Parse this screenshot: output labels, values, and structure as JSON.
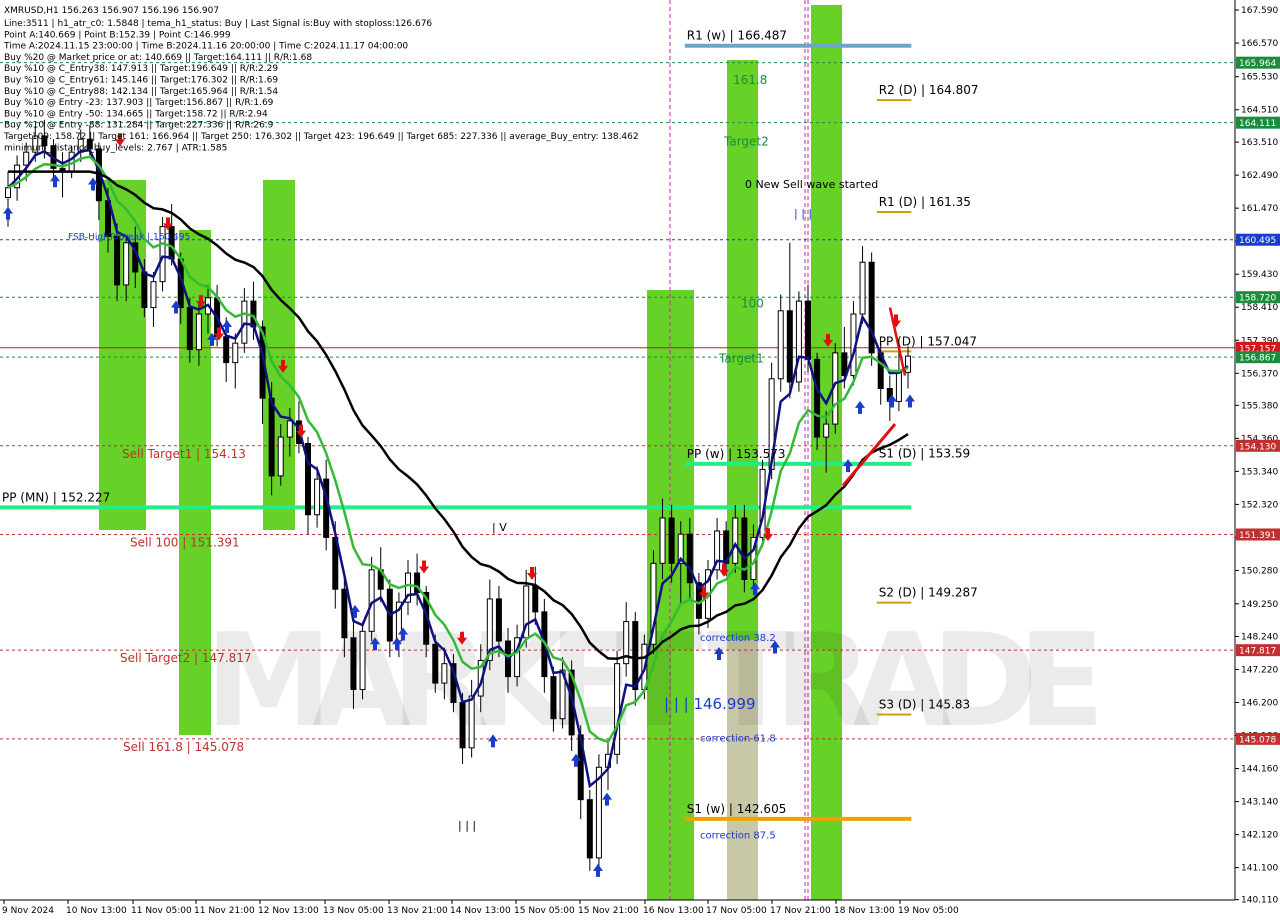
{
  "chart_data": {
    "type": "candlestick",
    "symbol": "XMRUSD,H1",
    "ohlc_header": "XMRUSD,H1  156.263 156.907 156.196 156.907",
    "info_lines": [
      "Line:3511  | h1_atr_c0: 1.5848  | tema_h1_status: Buy  | Last Signal is:Buy with stoploss:126.676",
      "Point A:140.669  | Point B:152.39  | Point C:146.999",
      "Time A:2024.11.15 23:00:00  | Time B:2024.11.16 20:00:00  | Time C:2024.11.17 04:00:00",
      "Buy %20 @ Market price or at: 140.669  || Target:164.111  || R/R:1.68",
      "Buy %10 @ C_Entry38: 147.913  || Target:196.649  || R/R:2.29",
      "Buy %10 @ C_Entry61: 145.146  || Target:176.302  || R/R:1.69",
      "Buy %10 @ C_Entry88: 142.134  || Target:165.964  || R/R:1.54",
      "Buy %10 @ Entry -23: 137.903  || Target:156.867  || R/R:1.69",
      "Buy %10 @ Entry -50: 134.665  || Target:158.72  || R/R:2.94",
      "Buy %10 @ Entry -88: 131.284  || Target:227.336  || R/R:26.9",
      "Target100: 158.72  || Target 161: 166.964  || Target 250: 176.302  || Target 423: 196.649  || Target 685: 227.336  || average_Buy_entry: 138.462",
      "minimum_distance_buy_levels: 2.767  | ATR:1.585"
    ],
    "y_axis": {
      "range": [
        140.1,
        167.9
      ],
      "ticks": [
        "167.590",
        "166.570",
        "165.530",
        "164.510",
        "163.510",
        "162.490",
        "161.470",
        "160.450",
        "159.430",
        "158.410",
        "157.390",
        "156.370",
        "155.380",
        "154.360",
        "153.340",
        "152.320",
        "151.300",
        "150.280",
        "149.250",
        "148.240",
        "147.220",
        "146.200",
        "145.180",
        "144.160",
        "143.140",
        "142.120",
        "141.100",
        "140.110"
      ]
    },
    "x_axis": {
      "labels": [
        "9 Nov 2024",
        "10 Nov 13:00",
        "11 Nov 05:00",
        "11 Nov 21:00",
        "12 Nov 13:00",
        "13 Nov 05:00",
        "13 Nov 21:00",
        "14 Nov 13:00",
        "15 Nov 05:00",
        "15 Nov 21:00",
        "16 Nov 13:00",
        "17 Nov 05:00",
        "17 Nov 21:00",
        "18 Nov 13:00",
        "19 Nov 05:00"
      ]
    },
    "price_badges": [
      {
        "label": "165.964",
        "value": 165.964,
        "color": "#1a8c3c"
      },
      {
        "label": "164.111",
        "value": 164.111,
        "color": "#1a8c3c"
      },
      {
        "label": "160.495",
        "value": 160.495,
        "color": "#1a3ccc"
      },
      {
        "label": "158.720",
        "value": 158.72,
        "color": "#1a8c3c"
      },
      {
        "label": "157.157",
        "value": 157.157,
        "color": "#d01818"
      },
      {
        "label": "156.867",
        "value": 156.867,
        "color": "#1a8c3c"
      },
      {
        "label": "154.130",
        "value": 154.13,
        "color": "#c03030"
      },
      {
        "label": "151.391",
        "value": 151.391,
        "color": "#c03030"
      },
      {
        "label": "147.817",
        "value": 147.817,
        "color": "#c03030"
      },
      {
        "label": "145.078",
        "value": 145.078,
        "color": "#c03030"
      }
    ],
    "levels": [
      {
        "name": "R1 (w)",
        "text": "R1 (w) | 166.487",
        "value": 166.487,
        "color": "#6aa6c8",
        "x0": 0.535,
        "x1": 0.712,
        "style": "thick"
      },
      {
        "name": "R2 (D)",
        "text": "R2 (D) | 164.807",
        "value": 164.807,
        "color": "#d0a000",
        "x0": 0.685,
        "x1": 0.712,
        "style": "short"
      },
      {
        "name": "R1 (D)",
        "text": "R1 (D) | 161.35",
        "value": 161.35,
        "color": "#d0a000",
        "x0": 0.685,
        "x1": 0.712,
        "style": "short"
      },
      {
        "name": "PP (D)",
        "text": "PP (D) | 157.047",
        "value": 157.047,
        "color": "#d0a000",
        "x0": 0.685,
        "x1": 0.712,
        "style": "short"
      },
      {
        "name": "S1 (D)",
        "text": "S1 (D) | 153.59",
        "value": 153.59,
        "color": "#d0a000",
        "x0": 0.685,
        "x1": 0.712,
        "style": "short"
      },
      {
        "name": "S2 (D)",
        "text": "S2 (D) | 149.287",
        "value": 149.287,
        "color": "#d0a000",
        "x0": 0.685,
        "x1": 0.712,
        "style": "short"
      },
      {
        "name": "S3 (D)",
        "text": "S3 (D) | 145.83",
        "value": 145.83,
        "color": "#d0a000",
        "x0": 0.685,
        "x1": 0.712,
        "style": "short"
      },
      {
        "name": "PP (w)",
        "text": "PP (w) | 153.573",
        "value": 153.573,
        "color": "#22ee88",
        "x0": 0.535,
        "x1": 0.712,
        "style": "thick"
      },
      {
        "name": "S1 (w)",
        "text": "S1 (w) | 142.605",
        "value": 142.605,
        "color": "#f0a000",
        "x0": 0.535,
        "x1": 0.712,
        "style": "thick"
      },
      {
        "name": "PP (MN)",
        "text": "PP (MN) | 152.227",
        "value": 152.227,
        "color": "#22ee88",
        "x0": 0.0,
        "x1": 0.712,
        "style": "thick"
      }
    ],
    "dashed_levels": [
      {
        "value": 165.964,
        "color": "#1a8c3c"
      },
      {
        "value": 164.111,
        "color": "#1a8c3c"
      },
      {
        "value": 160.495,
        "color": "#1a3ccc"
      },
      {
        "value": 158.72,
        "color": "#1a8c3c"
      },
      {
        "value": 156.867,
        "color": "#1a8c3c"
      },
      {
        "value": 154.13,
        "color": "#c03030"
      },
      {
        "value": 151.391,
        "color": "#c03030"
      },
      {
        "value": 147.817,
        "color": "#c03030"
      },
      {
        "value": 145.078,
        "color": "#c03030"
      }
    ],
    "red_solid_level": 157.157,
    "sell_labels": [
      {
        "text": "Sell Target1 | 154.13",
        "value": 154.13
      },
      {
        "text": "Sell 100 | 151.391",
        "value": 151.391
      },
      {
        "text": "Sell Target2 | 147.817",
        "value": 147.817
      },
      {
        "text": "Sell 161.8 | 145.078",
        "value": 145.078
      }
    ],
    "annotations": [
      {
        "text": "FSB-HighToBreak | 160.495",
        "value": 160.495,
        "color": "#1a3ccc"
      },
      {
        "text": "161.8",
        "value": 165.3,
        "color": "#1a8c3c"
      },
      {
        "text": "Target2",
        "value": 163.4,
        "color": "#1a8c3c"
      },
      {
        "text": "0 New Sell wave started",
        "value": 162.1,
        "color": "#000000"
      },
      {
        "text": "100",
        "value": 158.4,
        "color": "#1a8c3c"
      },
      {
        "text": "Target1",
        "value": 156.7,
        "color": "#1a8c3c"
      },
      {
        "text": "correction 38.2",
        "value": 148.1,
        "color": "#1a3ccc"
      },
      {
        "text": "| | | 146.999",
        "value": 146.0,
        "color": "#1a3ccc"
      },
      {
        "text": "correction 61.8",
        "value": 145.0,
        "color": "#1a3ccc"
      },
      {
        "text": "correction 87.5",
        "value": 142.0,
        "color": "#1a3ccc"
      },
      {
        "text": "| V",
        "value": 151.5,
        "color": "#000000"
      },
      {
        "text": "| | |",
        "value": 142.3,
        "color": "#000000"
      },
      {
        "text": "| | |",
        "value": 161.2,
        "color": "#1a3ccc"
      }
    ],
    "watermark": "MARKET TRADE",
    "candles": [
      [
        161.8,
        162.6,
        160.9,
        162.1
      ],
      [
        162.1,
        163.1,
        161.7,
        162.8
      ],
      [
        162.8,
        163.5,
        162.3,
        163.2
      ],
      [
        163.2,
        164.0,
        162.9,
        163.7
      ],
      [
        163.7,
        164.2,
        163.0,
        163.4
      ],
      [
        163.4,
        163.6,
        162.2,
        162.7
      ],
      [
        162.7,
        163.2,
        161.8,
        162.6
      ],
      [
        162.6,
        163.4,
        162.4,
        163.2
      ],
      [
        163.2,
        163.9,
        162.9,
        163.6
      ],
      [
        163.6,
        164.0,
        163.1,
        163.3
      ],
      [
        163.3,
        163.5,
        161.1,
        161.7
      ],
      [
        161.7,
        162.1,
        160.1,
        160.6
      ],
      [
        160.6,
        161.0,
        158.6,
        159.1
      ],
      [
        159.1,
        160.6,
        158.6,
        160.4
      ],
      [
        160.4,
        160.9,
        159.0,
        159.5
      ],
      [
        159.5,
        159.9,
        158.1,
        158.4
      ],
      [
        158.4,
        159.5,
        157.8,
        159.2
      ],
      [
        159.2,
        161.2,
        158.9,
        160.9
      ],
      [
        160.9,
        161.6,
        159.7,
        159.9
      ],
      [
        159.9,
        160.1,
        157.9,
        158.4
      ],
      [
        158.4,
        158.7,
        156.7,
        157.1
      ],
      [
        157.1,
        158.6,
        156.6,
        158.2
      ],
      [
        158.2,
        159.1,
        157.6,
        158.7
      ],
      [
        158.7,
        159.1,
        157.2,
        157.5
      ],
      [
        157.5,
        158.1,
        156.1,
        156.7
      ],
      [
        156.7,
        157.6,
        155.9,
        157.3
      ],
      [
        157.3,
        159.0,
        157.0,
        158.6
      ],
      [
        158.6,
        159.2,
        157.4,
        157.8
      ],
      [
        157.8,
        158.0,
        154.8,
        155.6
      ],
      [
        155.6,
        156.1,
        152.6,
        153.2
      ],
      [
        153.2,
        154.8,
        152.9,
        154.4
      ],
      [
        154.4,
        155.3,
        153.8,
        154.9
      ],
      [
        154.9,
        155.5,
        153.9,
        154.2
      ],
      [
        154.2,
        154.4,
        151.4,
        152.0
      ],
      [
        152.0,
        153.5,
        151.6,
        153.1
      ],
      [
        153.1,
        153.7,
        150.9,
        151.3
      ],
      [
        151.3,
        151.8,
        149.1,
        149.7
      ],
      [
        149.7,
        150.1,
        147.6,
        148.2
      ],
      [
        148.2,
        149.0,
        146.0,
        146.6
      ],
      [
        146.6,
        148.7,
        146.3,
        148.4
      ],
      [
        148.4,
        150.7,
        148.1,
        150.3
      ],
      [
        150.3,
        151.0,
        149.3,
        149.7
      ],
      [
        149.7,
        150.0,
        147.6,
        148.1
      ],
      [
        148.1,
        149.6,
        147.6,
        149.3
      ],
      [
        149.3,
        150.6,
        148.9,
        150.2
      ],
      [
        150.2,
        150.8,
        149.2,
        149.6
      ],
      [
        149.6,
        149.8,
        147.6,
        148.0
      ],
      [
        148.0,
        148.3,
        146.5,
        146.8
      ],
      [
        146.8,
        147.9,
        146.3,
        147.4
      ],
      [
        147.4,
        147.7,
        145.9,
        146.2
      ],
      [
        146.2,
        146.5,
        144.3,
        144.8
      ],
      [
        144.8,
        146.9,
        144.5,
        146.4
      ],
      [
        146.4,
        148.0,
        145.9,
        147.5
      ],
      [
        147.5,
        150.0,
        147.2,
        149.4
      ],
      [
        149.4,
        149.8,
        147.6,
        148.1
      ],
      [
        148.1,
        148.5,
        146.5,
        147.0
      ],
      [
        147.0,
        148.6,
        146.7,
        148.2
      ],
      [
        148.2,
        150.3,
        147.9,
        149.8
      ],
      [
        149.8,
        150.4,
        148.6,
        149.0
      ],
      [
        149.0,
        149.4,
        146.5,
        147.0
      ],
      [
        147.0,
        147.3,
        145.3,
        145.7
      ],
      [
        145.7,
        147.6,
        145.4,
        147.2
      ],
      [
        147.2,
        147.5,
        144.7,
        145.2
      ],
      [
        145.2,
        145.5,
        142.6,
        143.2
      ],
      [
        143.2,
        143.5,
        141.0,
        141.4
      ],
      [
        141.4,
        144.6,
        141.1,
        144.2
      ],
      [
        144.2,
        145.0,
        143.5,
        144.6
      ],
      [
        144.6,
        147.8,
        144.3,
        147.4
      ],
      [
        147.4,
        149.3,
        147.0,
        148.7
      ],
      [
        148.7,
        149.0,
        146.1,
        146.6
      ],
      [
        146.6,
        148.3,
        146.3,
        148.0
      ],
      [
        148.0,
        150.9,
        147.7,
        150.5
      ],
      [
        150.5,
        152.5,
        150.0,
        151.9
      ],
      [
        151.9,
        152.3,
        149.9,
        150.5
      ],
      [
        150.5,
        151.8,
        149.2,
        151.4
      ],
      [
        151.4,
        151.9,
        149.4,
        149.9
      ],
      [
        149.9,
        150.2,
        148.3,
        148.8
      ],
      [
        148.8,
        150.6,
        148.5,
        150.3
      ],
      [
        150.3,
        151.9,
        150.0,
        151.5
      ],
      [
        151.5,
        151.8,
        150.1,
        150.5
      ],
      [
        150.5,
        152.3,
        150.2,
        151.9
      ],
      [
        151.9,
        152.3,
        149.6,
        150.0
      ],
      [
        150.0,
        151.7,
        149.6,
        151.3
      ],
      [
        151.3,
        153.7,
        151.0,
        153.4
      ],
      [
        153.4,
        156.7,
        153.1,
        156.2
      ],
      [
        156.2,
        158.8,
        155.8,
        158.3
      ],
      [
        158.3,
        160.4,
        155.6,
        156.1
      ],
      [
        156.1,
        158.9,
        155.8,
        158.6
      ],
      [
        158.6,
        159.1,
        156.4,
        156.8
      ],
      [
        156.8,
        157.0,
        154.0,
        154.4
      ],
      [
        154.4,
        155.2,
        153.3,
        154.8
      ],
      [
        154.8,
        157.3,
        154.5,
        157.0
      ],
      [
        157.0,
        157.8,
        155.9,
        156.3
      ],
      [
        156.3,
        158.6,
        156.0,
        158.2
      ],
      [
        158.2,
        160.3,
        157.9,
        159.8
      ],
      [
        159.8,
        160.1,
        156.6,
        157.0
      ],
      [
        157.0,
        157.3,
        155.4,
        155.9
      ],
      [
        155.9,
        156.3,
        154.9,
        155.5
      ],
      [
        155.5,
        157.2,
        155.2,
        156.4
      ],
      [
        156.4,
        157.2,
        155.9,
        156.9
      ]
    ]
  }
}
